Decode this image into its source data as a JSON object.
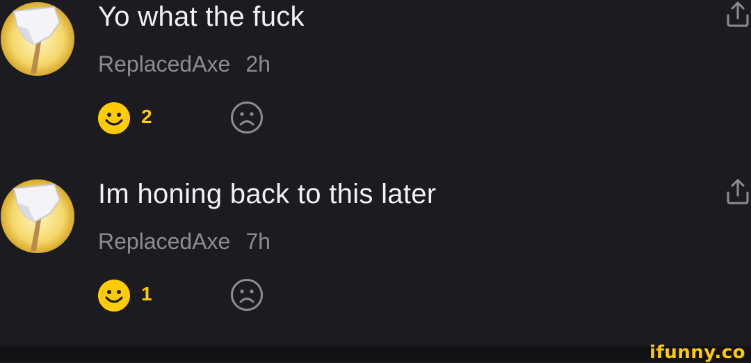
{
  "comments": [
    {
      "text": "Yo what the fuck",
      "username": "ReplacedAxe",
      "time": "2h",
      "smile_count": "2"
    },
    {
      "text": "Im honing back to this later",
      "username": "ReplacedAxe",
      "time": "7h",
      "smile_count": "1"
    }
  ],
  "icons": {
    "avatar": "axe-avatar-icon",
    "share": "share-icon",
    "smile": "smile-icon",
    "unsmile": "frown-icon"
  },
  "colors": {
    "background": "#1c1b21",
    "accent": "#ffcc00",
    "text": "#f2f2f4",
    "muted": "#8d8c93"
  },
  "watermark": "ifunny.co"
}
